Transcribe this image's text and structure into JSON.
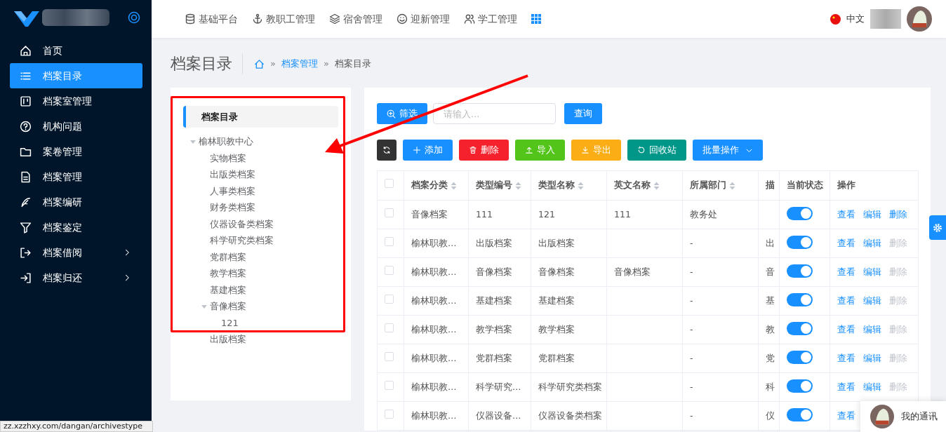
{
  "sidebar": {
    "items": [
      {
        "label": "首页",
        "selected": false,
        "has_submenu": false
      },
      {
        "label": "档案目录",
        "selected": true,
        "has_submenu": false
      },
      {
        "label": "档案室管理",
        "selected": false,
        "has_submenu": false
      },
      {
        "label": "机构问题",
        "selected": false,
        "has_submenu": false
      },
      {
        "label": "案卷管理",
        "selected": false,
        "has_submenu": false
      },
      {
        "label": "档案管理",
        "selected": false,
        "has_submenu": false
      },
      {
        "label": "档案编研",
        "selected": false,
        "has_submenu": false
      },
      {
        "label": "档案鉴定",
        "selected": false,
        "has_submenu": false
      },
      {
        "label": "档案借阅",
        "selected": false,
        "has_submenu": true
      },
      {
        "label": "档案归还",
        "selected": false,
        "has_submenu": true
      }
    ]
  },
  "top_nav": {
    "items": [
      "基础平台",
      "教职工管理",
      "宿舍管理",
      "迎新管理",
      "学工管理"
    ]
  },
  "header": {
    "language": "中文"
  },
  "page": {
    "title": "档案目录",
    "breadcrumb_separator": "»",
    "breadcrumb": [
      "档案管理",
      "档案目录"
    ]
  },
  "tree": {
    "title": "档案目录",
    "nodes": [
      {
        "label": "榆林职教中心",
        "expanded": true,
        "children": [
          {
            "label": "实物档案"
          },
          {
            "label": "出版类档案"
          },
          {
            "label": "人事类档案"
          },
          {
            "label": "财务类档案"
          },
          {
            "label": "仪器设备类档案"
          },
          {
            "label": "科学研究类档案"
          },
          {
            "label": "党群档案"
          },
          {
            "label": "教学档案"
          },
          {
            "label": "基建档案"
          },
          {
            "label": "音像档案",
            "expanded": true,
            "children": [
              {
                "label": "121"
              }
            ]
          },
          {
            "label": "出版档案"
          }
        ]
      }
    ]
  },
  "toolbar": {
    "filter_button": "筛选",
    "search": {
      "placeholder": "请输入..."
    },
    "query_button": "查询",
    "actions": [
      {
        "kind": "refresh"
      },
      {
        "kind": "add",
        "label": "添加"
      },
      {
        "kind": "delete",
        "label": "删除"
      },
      {
        "kind": "import",
        "label": "导入"
      },
      {
        "kind": "export",
        "label": "导出"
      },
      {
        "kind": "recycle",
        "label": "回收站"
      },
      {
        "kind": "batch",
        "label": "批量操作"
      }
    ]
  },
  "table": {
    "all_checked": false,
    "columns": [
      {
        "label": "档案分类",
        "sortable": true
      },
      {
        "label": "类型编号",
        "sortable": true
      },
      {
        "label": "类型名称",
        "sortable": true
      },
      {
        "label": "英文名称",
        "sortable": true
      },
      {
        "label": "所属部门",
        "sortable": true
      },
      {
        "label": "描",
        "sortable": false
      },
      {
        "label": "当前状态",
        "sortable": false
      },
      {
        "label": "操作",
        "sortable": false
      }
    ],
    "rows": [
      {
        "checked": false,
        "cells": [
          "音像档案",
          "111",
          "121",
          "111",
          "教务处",
          ""
        ],
        "enabled": true,
        "actions": [
          {
            "label": "查看",
            "disabled": false
          },
          {
            "label": "编辑",
            "disabled": false
          },
          {
            "label": "删除",
            "disabled": false
          }
        ]
      },
      {
        "checked": false,
        "cells": [
          "榆林职教…",
          "出版档案",
          "出版档案",
          "",
          "-",
          "出"
        ],
        "enabled": true,
        "actions": [
          {
            "label": "查看",
            "disabled": false
          },
          {
            "label": "编辑",
            "disabled": false
          },
          {
            "label": "删除",
            "disabled": true
          }
        ]
      },
      {
        "checked": false,
        "cells": [
          "榆林职教…",
          "音像档案",
          "音像档案",
          "音像档案",
          "-",
          "音"
        ],
        "enabled": true,
        "actions": [
          {
            "label": "查看",
            "disabled": false
          },
          {
            "label": "编辑",
            "disabled": false
          },
          {
            "label": "删除",
            "disabled": true
          }
        ]
      },
      {
        "checked": false,
        "cells": [
          "榆林职教…",
          "基建档案",
          "基建档案",
          "",
          "-",
          "基"
        ],
        "enabled": true,
        "actions": [
          {
            "label": "查看",
            "disabled": false
          },
          {
            "label": "编辑",
            "disabled": false
          },
          {
            "label": "删除",
            "disabled": true
          }
        ]
      },
      {
        "checked": false,
        "cells": [
          "榆林职教…",
          "教学档案",
          "教学档案",
          "",
          "-",
          "教"
        ],
        "enabled": true,
        "actions": [
          {
            "label": "查看",
            "disabled": false
          },
          {
            "label": "编辑",
            "disabled": false
          },
          {
            "label": "删除",
            "disabled": true
          }
        ]
      },
      {
        "checked": false,
        "cells": [
          "榆林职教…",
          "党群档案",
          "党群档案",
          "",
          "-",
          "党"
        ],
        "enabled": true,
        "actions": [
          {
            "label": "查看",
            "disabled": false
          },
          {
            "label": "编辑",
            "disabled": false
          },
          {
            "label": "删除",
            "disabled": true
          }
        ]
      },
      {
        "checked": false,
        "cells": [
          "榆林职教…",
          "科学研究…",
          "科学研究类档案",
          "",
          "-",
          "科"
        ],
        "enabled": true,
        "actions": [
          {
            "label": "查看",
            "disabled": false
          },
          {
            "label": "编辑",
            "disabled": false
          },
          {
            "label": "删除",
            "disabled": true
          }
        ]
      },
      {
        "checked": false,
        "cells": [
          "榆林职教…",
          "仪器设备…",
          "仪器设备类档案",
          "",
          "-",
          "仪"
        ],
        "enabled": true,
        "actions": [
          {
            "label": "查看",
            "disabled": false
          }
        ]
      }
    ]
  },
  "status_bar": "zz.xzzhxy.com/dangan/archivestype",
  "chat": {
    "label": "我的通讯"
  }
}
